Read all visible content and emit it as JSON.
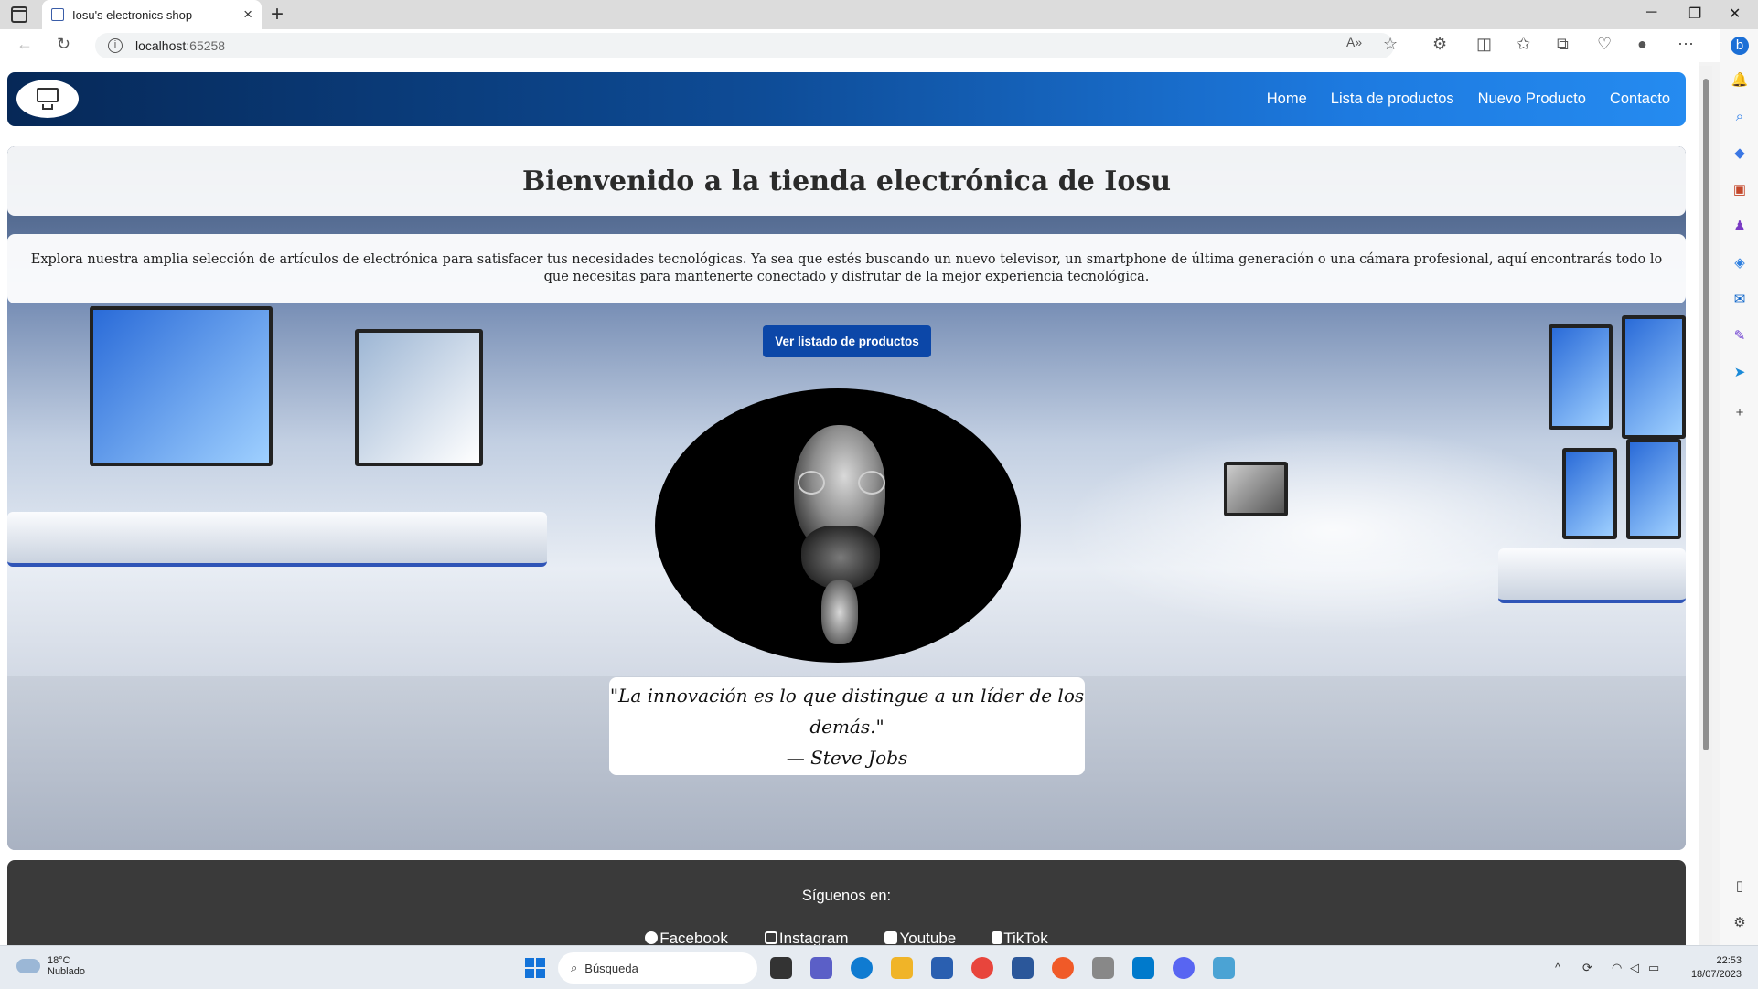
{
  "browser": {
    "tab_title": "Iosu's electronics shop",
    "url_host": "localhost",
    "url_port": ":65258"
  },
  "site": {
    "nav": [
      "Home",
      "Lista de productos",
      "Nuevo Producto",
      "Contacto"
    ],
    "title": "Bienvenido a la tienda electrónica de Iosu",
    "description": "Explora nuestra amplia selección de artículos de electrónica para satisfacer tus necesidades tecnológicas. Ya sea que estés buscando un nuevo televisor, un smartphone de última generación o una cámara profesional, aquí encontrarás todo lo que necesitas para mantenerte conectado y disfrutar de la mejor experiencia tecnológica.",
    "cta_label": "Ver listado de productos",
    "quote": "\"La innovación es lo que distingue a un líder de los demás.\"",
    "quote_author": "— Steve Jobs",
    "footer_follow": "Síguenos en:",
    "socials": [
      "Facebook",
      "Instagram",
      "Youtube",
      "TikTok"
    ]
  },
  "taskbar": {
    "weather_temp": "18°C",
    "weather_desc": "Nublado",
    "search_placeholder": "Búsqueda",
    "time": "22:53",
    "date": "18/07/2023"
  }
}
